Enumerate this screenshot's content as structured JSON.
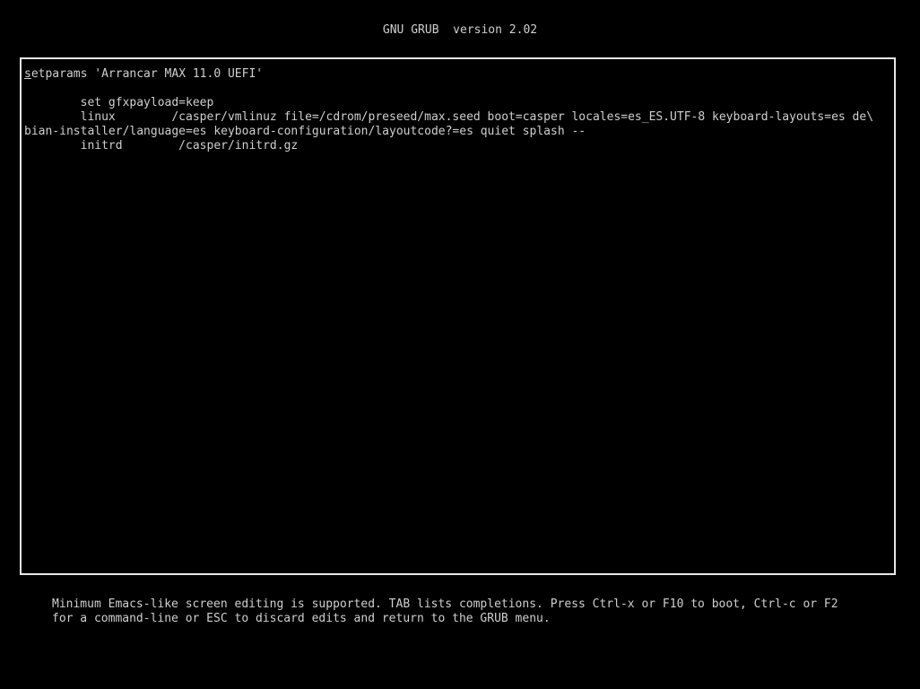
{
  "header": {
    "title": "GNU GRUB  version 2.02"
  },
  "editor": {
    "first_line_cursor": "s",
    "first_line_rest": "etparams 'Arrancar MAX 11.0 UEFI'",
    "lines": [
      "",
      "        set gfxpayload=keep",
      "        linux        /casper/vmlinuz file=/cdrom/preseed/max.seed boot=casper locales=es_ES.UTF-8 keyboard-layouts=es de\\",
      "bian-installer/language=es keyboard-configuration/layoutcode?=es quiet splash --",
      "        initrd        /casper/initrd.gz"
    ]
  },
  "help": {
    "line1": "Minimum Emacs-like screen editing is supported. TAB lists completions. Press Ctrl-x or F10 to boot, Ctrl-c or F2",
    "line2": "for a command-line or ESC to discard edits and return to the GRUB menu."
  }
}
